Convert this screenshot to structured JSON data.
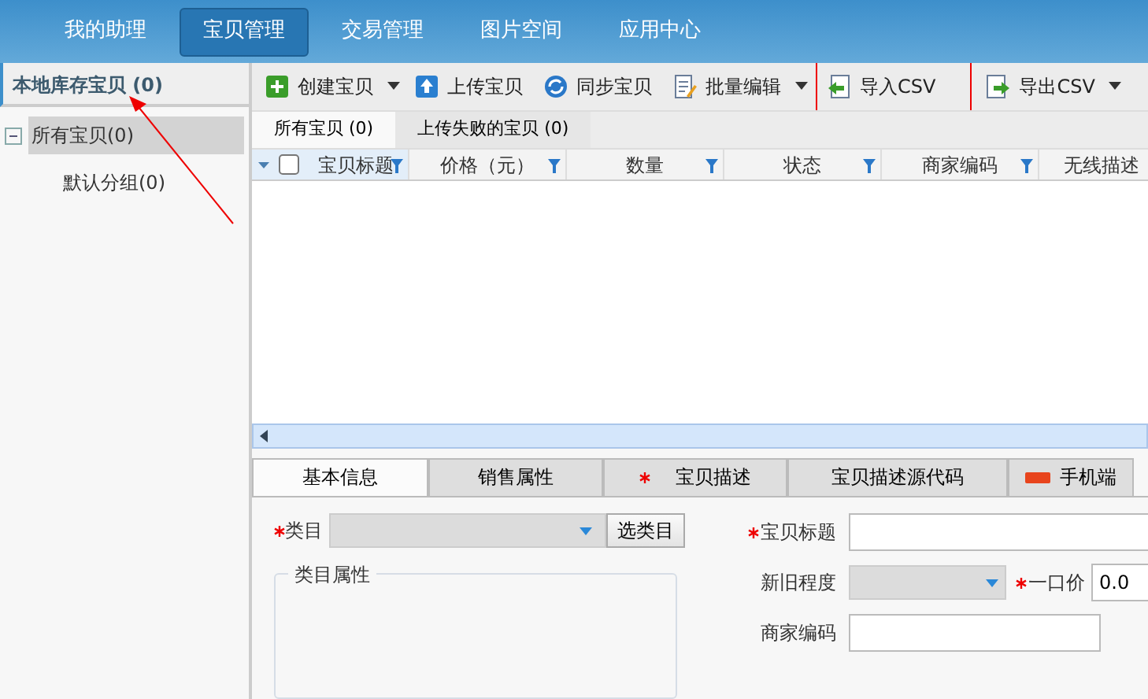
{
  "nav": [
    {
      "label": "我的助理",
      "selected": false
    },
    {
      "label": "宝贝管理",
      "selected": true
    },
    {
      "label": "交易管理",
      "selected": false
    },
    {
      "label": "图片空间",
      "selected": false
    },
    {
      "label": "应用中心",
      "selected": false
    }
  ],
  "sidebar": {
    "title": "本地库存宝贝 (0)",
    "tree": [
      {
        "label": "所有宝贝(0)",
        "selected": true,
        "expanded": true,
        "children": [
          {
            "label": "默认分组(0)",
            "selected": false
          }
        ]
      }
    ]
  },
  "toolbar": [
    {
      "label": "创建宝贝",
      "dropdown": true,
      "highlighted": false
    },
    {
      "label": "上传宝贝",
      "dropdown": false,
      "highlighted": false
    },
    {
      "label": "同步宝贝",
      "dropdown": false,
      "highlighted": false
    },
    {
      "label": "批量编辑",
      "dropdown": true,
      "highlighted": false
    },
    {
      "label": "导入CSV",
      "dropdown": false,
      "highlighted": true
    },
    {
      "label": "导出CSV",
      "dropdown": true,
      "highlighted": false
    }
  ],
  "list_tabs": [
    {
      "label": "所有宝贝 (0)",
      "selected": true
    },
    {
      "label": "上传失败的宝贝 (0)",
      "selected": false
    }
  ],
  "table": {
    "columns": [
      "宝贝标题",
      "价格（元）",
      "数量",
      "状态",
      "商家编码",
      "无线描述"
    ],
    "select_all": {
      "checked": false
    }
  },
  "detail_tabs": [
    {
      "label": "基本信息",
      "selected": true,
      "required": false,
      "hot": false
    },
    {
      "label": "销售属性",
      "selected": false,
      "required": false,
      "hot": false
    },
    {
      "label": "宝贝描述",
      "selected": false,
      "required": true,
      "hot": false
    },
    {
      "label": "宝贝描述源代码",
      "selected": false,
      "required": false,
      "hot": false
    },
    {
      "label": "手机端",
      "selected": false,
      "required": false,
      "hot": true
    }
  ],
  "form": {
    "category_label": "类目",
    "category_required": true,
    "choose_button": "选类目",
    "attributes_title": "类目属性",
    "fields": [
      {
        "label": "宝贝标题",
        "required": true,
        "kind": "text"
      },
      {
        "label": "新旧程度",
        "required": false,
        "kind": "select",
        "side_label": "一口价",
        "side_required": true,
        "side_value": "0.0"
      },
      {
        "label": "商家编码",
        "required": false,
        "kind": "text"
      }
    ]
  }
}
